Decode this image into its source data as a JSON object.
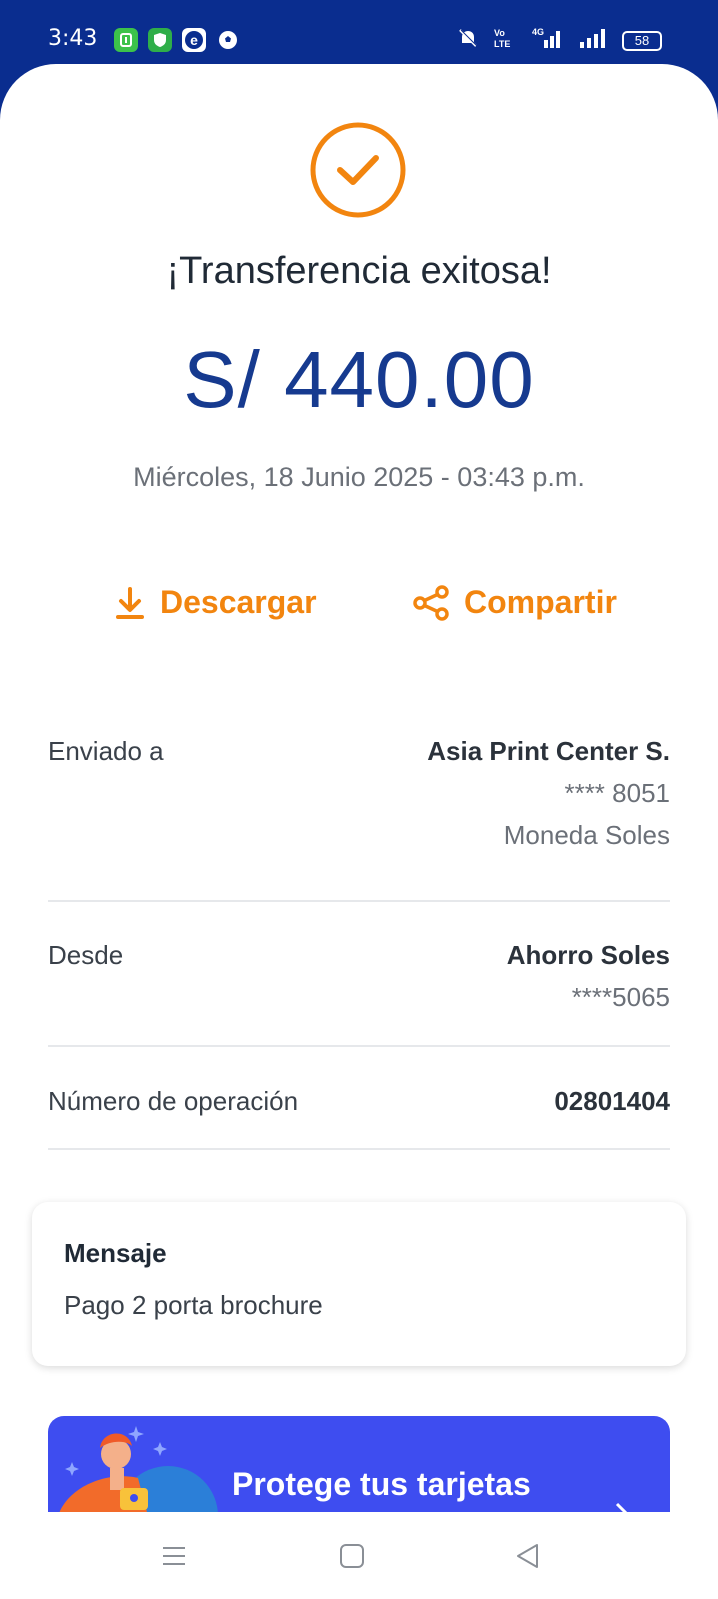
{
  "status_bar": {
    "time": "3:43",
    "battery": "58",
    "icons": [
      "app-icon-green",
      "shield-app-icon",
      "e-app-icon",
      "soccer-ball-icon",
      "mute-icon",
      "volte-icon",
      "4g-signal-icon",
      "signal-icon",
      "battery-icon"
    ]
  },
  "receipt": {
    "title": "¡Transferencia exitosa!",
    "amount": "S/ 440.00",
    "datetime": "Miércoles, 18 Junio 2025 - 03:43 p.m.",
    "download_label": "Descargar",
    "share_label": "Compartir"
  },
  "details": {
    "sent_to_label": "Enviado a",
    "sent_to_name": "Asia Print Center S.",
    "sent_to_account": "**** 8051",
    "sent_to_currency": "Moneda Soles",
    "from_label": "Desde",
    "from_account_name": "Ahorro Soles",
    "from_account_number": "****5065",
    "operation_label": "Número de operación",
    "operation_number": "02801404"
  },
  "message": {
    "title": "Mensaje",
    "text": "Pago 2 porta brochure"
  },
  "promo": {
    "text": "Protege tus tarjetas"
  },
  "colors": {
    "brand_blue": "#0a2d8f",
    "accent_orange": "#f2850f",
    "amount_blue": "#163a8f",
    "promo_blue": "#3e4df0"
  }
}
